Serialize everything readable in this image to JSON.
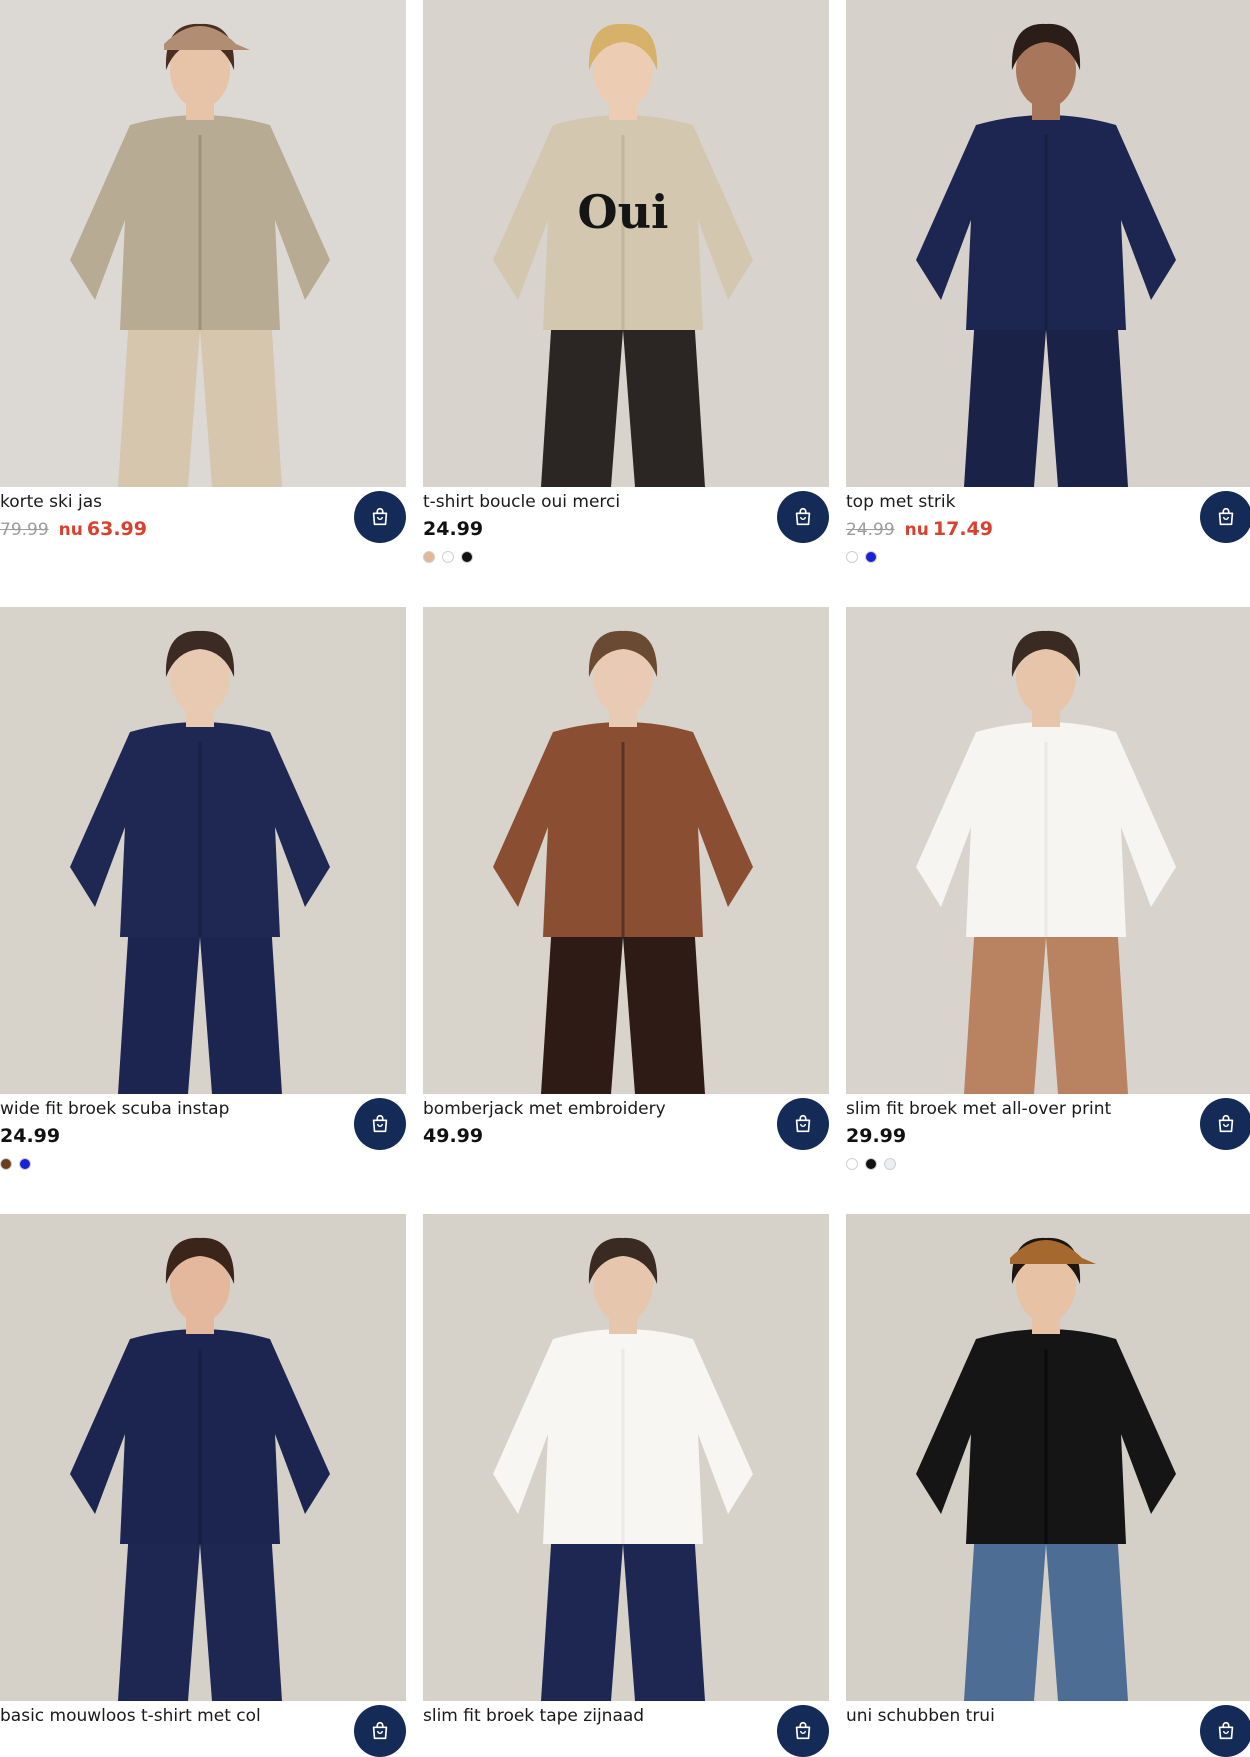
{
  "products": [
    {
      "name": "korte ski jas",
      "old_price": "79.99",
      "now_label": "nu",
      "price": "63.99",
      "swatches": [],
      "image": {
        "bg": "#dcd9d4",
        "top": "#b8ab93",
        "top_shade": "#8e826d",
        "bottom": "#d6c6ad",
        "skin": "#e7c3a8",
        "hair": "#4a2e22",
        "cap": "#b08d73"
      }
    },
    {
      "name": "t-shirt boucle oui merci",
      "price": "24.99",
      "swatches": [
        "#e2b89a",
        "#ffffff",
        "#111111"
      ],
      "image": {
        "bg": "#d8d4cd",
        "top": "#d3c7b0",
        "top_shade": "#b7aa90",
        "bottom": "#2b2623",
        "skin": "#eccdb3",
        "hair": "#d6b16a",
        "print": "Oui"
      }
    },
    {
      "name": "top met strik",
      "old_price": "24.99",
      "now_label": "nu",
      "price": "17.49",
      "swatches": [
        "#ffffff",
        "#1a22d6"
      ],
      "image": {
        "bg": "#d6d2cb",
        "top": "#1d2650",
        "top_shade": "#141b3b",
        "bottom": "#1b2248",
        "skin": "#a8765a",
        "hair": "#2b1d17"
      }
    },
    {
      "name": "wide fit broek scuba instap",
      "price": "24.99",
      "swatches": [
        "#6b3d1f",
        "#1a22d6"
      ],
      "image": {
        "bg": "#d7d2ca",
        "top": "#1e2853",
        "top_shade": "#151d3d",
        "bottom": "#1c2550",
        "skin": "#e8c9b1",
        "hair": "#3b2b22"
      }
    },
    {
      "name": "bomberjack met embroidery",
      "price": "49.99",
      "swatches": [],
      "image": {
        "bg": "#d8d3cb",
        "top": "#8a4f32",
        "top_shade": "#3a2218",
        "bottom": "#2e1b16",
        "skin": "#e9cbb5",
        "hair": "#6a4a32"
      }
    },
    {
      "name": "slim fit broek met all-over print",
      "price": "29.99",
      "swatches": [
        "#ffffff",
        "#111111",
        "#eceef3"
      ],
      "image": {
        "bg": "#d8d3cc",
        "top": "#f6f5f2",
        "top_shade": "#e3e1dc",
        "bottom": "#b98361",
        "skin": "#e6c5ab",
        "hair": "#3a2b22"
      }
    },
    {
      "name": "basic mouwloos t-shirt met col",
      "price": "",
      "swatches": [],
      "image": {
        "bg": "#d5d0c8",
        "top": "#1c2550",
        "top_shade": "#141b3c",
        "bottom": "#1d2752",
        "skin": "#e4b89c",
        "hair": "#3b241a"
      }
    },
    {
      "name": "slim fit broek tape zijnaad",
      "price": "",
      "swatches": [],
      "image": {
        "bg": "#d6d1c9",
        "top": "#f7f6f3",
        "top_shade": "#e5e3de",
        "bottom": "#1e2752",
        "skin": "#e6c7ae",
        "hair": "#3a2b22"
      }
    },
    {
      "name": "uni schubben trui",
      "price": "",
      "swatches": [],
      "image": {
        "bg": "#d4cfc7",
        "top": "#151515",
        "top_shade": "#050505",
        "bottom": "#4e6d95",
        "skin": "#e7c2a5",
        "hair": "#1f1510",
        "cap": "#a5682f"
      }
    }
  ],
  "icons": {
    "cart": "shopping-bag-icon"
  },
  "colors": {
    "cart_button": "#142b57",
    "sale": "#d9412f",
    "old_price": "#9c9c9c"
  }
}
